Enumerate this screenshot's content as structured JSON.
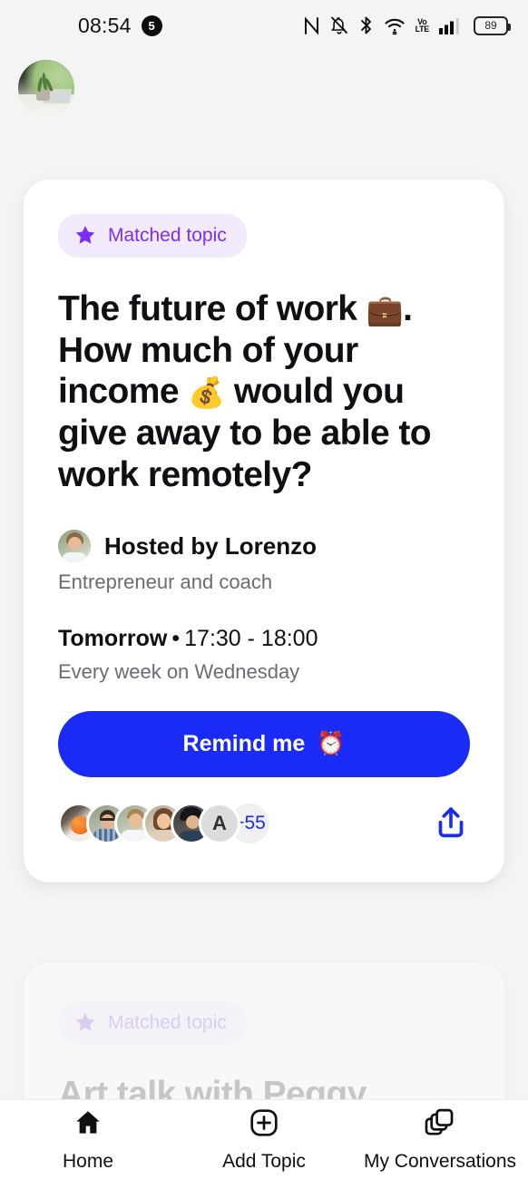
{
  "status_bar": {
    "time": "08:54",
    "notification_count": "5",
    "battery_level": "89",
    "network_label": "VoLTE",
    "icons": [
      "nfc-icon",
      "notifications-off-icon",
      "bluetooth-icon",
      "wifi-icon",
      "volte-icon",
      "signal-bars-icon",
      "battery-icon"
    ]
  },
  "header": {
    "profile_avatar": "user-profile-photo"
  },
  "cards": [
    {
      "badge": "Matched topic",
      "badge_icon": "star-icon",
      "title_before": "The future of work ",
      "title_emoji_1": "💼",
      "title_middle": ". How much of your income ",
      "title_emoji_2": "💰",
      "title_after": " would you give away to be able to work remotely?",
      "host_name": "Hosted by Lorenzo",
      "host_subtitle": "Entrepreneur and coach",
      "schedule_day": "Tomorrow",
      "schedule_separator": "•",
      "schedule_time": "17:30 - 18:00",
      "schedule_recurrence": "Every week on Wednesday",
      "cta_label": "Remind me",
      "cta_emoji": "⏰",
      "participants_extra": "+55",
      "participant_letter": "A",
      "share_icon": "share-icon"
    },
    {
      "badge": "Matched topic",
      "badge_icon": "star-icon",
      "title": "Art talk with Peggy"
    }
  ],
  "bottom_nav": [
    {
      "label": "Home",
      "icon": "home-icon"
    },
    {
      "label": "Add Topic",
      "icon": "plus-circle-icon"
    },
    {
      "label": "My Conversations",
      "icon": "stacked-windows-icon"
    }
  ],
  "colors": {
    "accent_blue": "#1a2bf5",
    "badge_purple": "#7b2ff2",
    "badge_bg": "#f1eafd",
    "page_bg": "#f4f4f5"
  }
}
